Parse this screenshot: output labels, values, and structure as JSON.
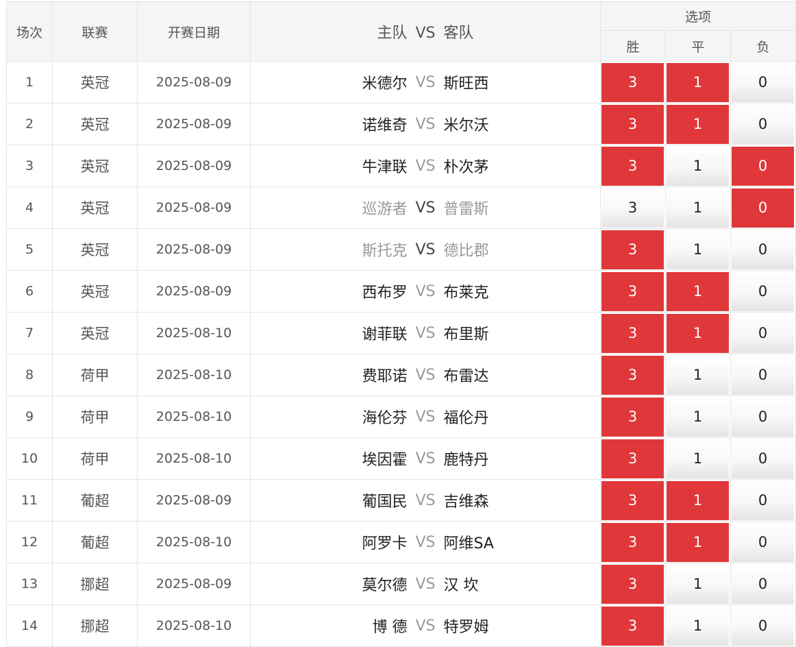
{
  "header": {
    "no": "场次",
    "league": "联赛",
    "date": "开赛日期",
    "home": "主队",
    "vs": "VS",
    "away": "客队",
    "options": "选项",
    "win": "胜",
    "draw": "平",
    "loss": "负"
  },
  "colors": {
    "selected": "#e0373a",
    "unselected": "#f2f2f2",
    "header_bg": "#f5f5f5"
  },
  "rows": [
    {
      "no": "1",
      "league": "英冠",
      "date": "2025-08-09",
      "home": "米德尔",
      "vs": "VS",
      "away": "斯旺西",
      "dim": false,
      "win": {
        "v": "3",
        "sel": true
      },
      "draw": {
        "v": "1",
        "sel": true
      },
      "loss": {
        "v": "0",
        "sel": false
      }
    },
    {
      "no": "2",
      "league": "英冠",
      "date": "2025-08-09",
      "home": "诺维奇",
      "vs": "VS",
      "away": "米尔沃",
      "dim": false,
      "win": {
        "v": "3",
        "sel": true
      },
      "draw": {
        "v": "1",
        "sel": true
      },
      "loss": {
        "v": "0",
        "sel": false
      }
    },
    {
      "no": "3",
      "league": "英冠",
      "date": "2025-08-09",
      "home": "牛津联",
      "vs": "VS",
      "away": "朴次茅",
      "dim": false,
      "win": {
        "v": "3",
        "sel": true
      },
      "draw": {
        "v": "1",
        "sel": false
      },
      "loss": {
        "v": "0",
        "sel": true
      }
    },
    {
      "no": "4",
      "league": "英冠",
      "date": "2025-08-09",
      "home": "巡游者",
      "vs": "VS",
      "away": "普雷斯",
      "dim": true,
      "win": {
        "v": "3",
        "sel": false
      },
      "draw": {
        "v": "1",
        "sel": false
      },
      "loss": {
        "v": "0",
        "sel": true
      }
    },
    {
      "no": "5",
      "league": "英冠",
      "date": "2025-08-09",
      "home": "斯托克",
      "vs": "VS",
      "away": "德比郡",
      "dim": true,
      "win": {
        "v": "3",
        "sel": true
      },
      "draw": {
        "v": "1",
        "sel": false
      },
      "loss": {
        "v": "0",
        "sel": false
      }
    },
    {
      "no": "6",
      "league": "英冠",
      "date": "2025-08-09",
      "home": "西布罗",
      "vs": "VS",
      "away": "布莱克",
      "dim": false,
      "win": {
        "v": "3",
        "sel": true
      },
      "draw": {
        "v": "1",
        "sel": true
      },
      "loss": {
        "v": "0",
        "sel": false
      }
    },
    {
      "no": "7",
      "league": "英冠",
      "date": "2025-08-10",
      "home": "谢菲联",
      "vs": "VS",
      "away": "布里斯",
      "dim": false,
      "win": {
        "v": "3",
        "sel": true
      },
      "draw": {
        "v": "1",
        "sel": true
      },
      "loss": {
        "v": "0",
        "sel": false
      }
    },
    {
      "no": "8",
      "league": "荷甲",
      "date": "2025-08-10",
      "home": "费耶诺",
      "vs": "VS",
      "away": "布雷达",
      "dim": false,
      "win": {
        "v": "3",
        "sel": true
      },
      "draw": {
        "v": "1",
        "sel": false
      },
      "loss": {
        "v": "0",
        "sel": false
      }
    },
    {
      "no": "9",
      "league": "荷甲",
      "date": "2025-08-10",
      "home": "海伦芬",
      "vs": "VS",
      "away": "福伦丹",
      "dim": false,
      "win": {
        "v": "3",
        "sel": true
      },
      "draw": {
        "v": "1",
        "sel": false
      },
      "loss": {
        "v": "0",
        "sel": false
      }
    },
    {
      "no": "10",
      "league": "荷甲",
      "date": "2025-08-10",
      "home": "埃因霍",
      "vs": "VS",
      "away": "鹿特丹",
      "dim": false,
      "win": {
        "v": "3",
        "sel": true
      },
      "draw": {
        "v": "1",
        "sel": false
      },
      "loss": {
        "v": "0",
        "sel": false
      }
    },
    {
      "no": "11",
      "league": "葡超",
      "date": "2025-08-09",
      "home": "葡国民",
      "vs": "VS",
      "away": "吉维森",
      "dim": false,
      "win": {
        "v": "3",
        "sel": true
      },
      "draw": {
        "v": "1",
        "sel": true
      },
      "loss": {
        "v": "0",
        "sel": false
      }
    },
    {
      "no": "12",
      "league": "葡超",
      "date": "2025-08-10",
      "home": "阿罗卡",
      "vs": "VS",
      "away": "阿维SA",
      "dim": false,
      "win": {
        "v": "3",
        "sel": true
      },
      "draw": {
        "v": "1",
        "sel": true
      },
      "loss": {
        "v": "0",
        "sel": false
      }
    },
    {
      "no": "13",
      "league": "挪超",
      "date": "2025-08-09",
      "home": "莫尔德",
      "vs": "VS",
      "away": "汉 坎",
      "dim": false,
      "win": {
        "v": "3",
        "sel": true
      },
      "draw": {
        "v": "1",
        "sel": false
      },
      "loss": {
        "v": "0",
        "sel": false
      }
    },
    {
      "no": "14",
      "league": "挪超",
      "date": "2025-08-10",
      "home": "博 德",
      "vs": "VS",
      "away": "特罗姆",
      "dim": false,
      "win": {
        "v": "3",
        "sel": true
      },
      "draw": {
        "v": "1",
        "sel": false
      },
      "loss": {
        "v": "0",
        "sel": false
      }
    }
  ]
}
